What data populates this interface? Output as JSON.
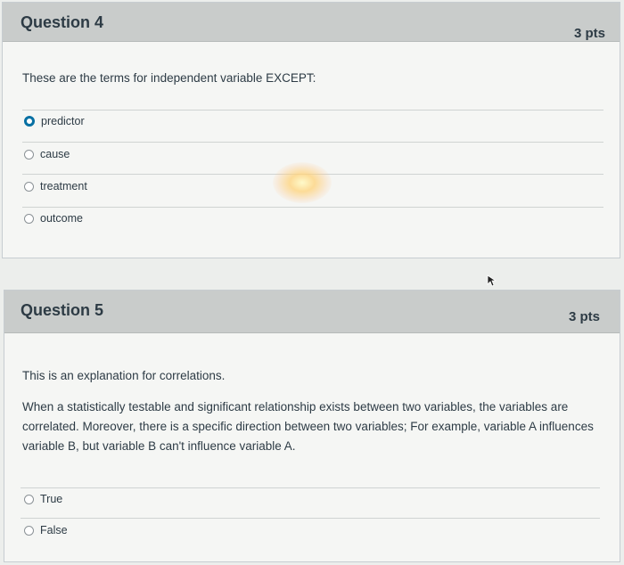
{
  "question4": {
    "title": "Question 4",
    "points": "3 pts",
    "text": "These are the terms for independent variable EXCEPT:",
    "answers": [
      {
        "label": "predictor",
        "selected": true
      },
      {
        "label": "cause",
        "selected": false
      },
      {
        "label": "treatment",
        "selected": false
      },
      {
        "label": "outcome",
        "selected": false
      }
    ]
  },
  "question5": {
    "title": "Question 5",
    "points": "3 pts",
    "text_intro": "This is an explanation for correlations.",
    "text_body": "When a statistically testable and significant relationship exists between two variables, the variables are correlated. Moreover, there is a specific direction between two variables; For example, variable A influences variable B, but variable B can't influence variable A.",
    "answers": [
      {
        "label": "True",
        "selected": false
      },
      {
        "label": "False",
        "selected": false
      }
    ]
  },
  "colors": {
    "header_bg": "#c9cccb",
    "card_bg": "#f5f6f4",
    "selected_radio": "#0770a3",
    "text": "#2d3b45"
  },
  "icons": [
    "radio-selected-icon",
    "radio-unselected-icon",
    "mouse-pointer-icon"
  ]
}
